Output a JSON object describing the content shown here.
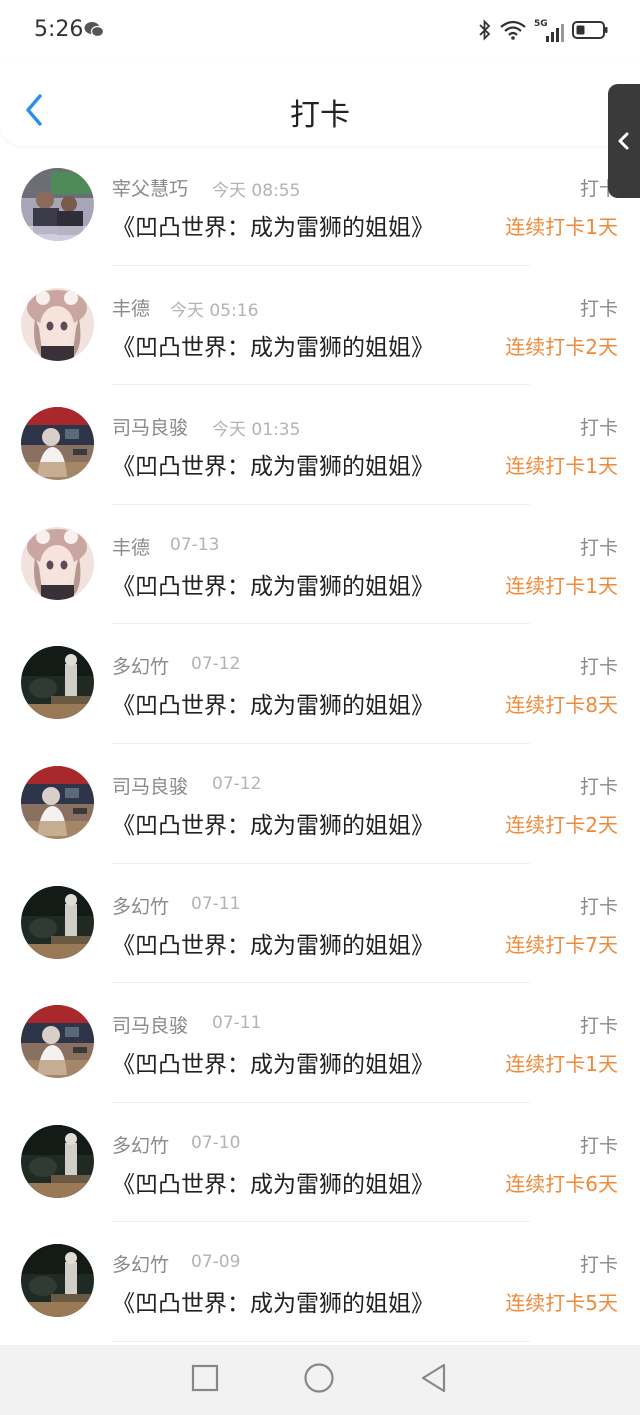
{
  "status_bar": {
    "time": "5:26",
    "network": "5G"
  },
  "header": {
    "title": "打卡"
  },
  "rows": [
    {
      "name": "宰父慧巧",
      "time": "今天 08:55",
      "book": "《凹凸世界：成为雷狮的姐姐》",
      "action": "打卡",
      "streak": "连续打卡1天",
      "avatar_style": "photo-group"
    },
    {
      "name": "丰德",
      "time": "今天 05:16",
      "book": "《凹凸世界：成为雷狮的姐姐》",
      "action": "打卡",
      "streak": "连续打卡2天",
      "avatar_style": "anime-girl"
    },
    {
      "name": "司马良骏",
      "time": "今天 01:35",
      "book": "《凹凸世界：成为雷狮的姐姐》",
      "action": "打卡",
      "streak": "连续打卡1天",
      "avatar_style": "classroom"
    },
    {
      "name": "丰德",
      "time": "07-13",
      "book": "《凹凸世界：成为雷狮的姐姐》",
      "action": "打卡",
      "streak": "连续打卡1天",
      "avatar_style": "anime-girl"
    },
    {
      "name": "多幻竹",
      "time": "07-12",
      "book": "《凹凸世界：成为雷狮的姐姐》",
      "action": "打卡",
      "streak": "连续打卡8天",
      "avatar_style": "dark-room"
    },
    {
      "name": "司马良骏",
      "time": "07-12",
      "book": "《凹凸世界：成为雷狮的姐姐》",
      "action": "打卡",
      "streak": "连续打卡2天",
      "avatar_style": "classroom"
    },
    {
      "name": "多幻竹",
      "time": "07-11",
      "book": "《凹凸世界：成为雷狮的姐姐》",
      "action": "打卡",
      "streak": "连续打卡7天",
      "avatar_style": "dark-room"
    },
    {
      "name": "司马良骏",
      "time": "07-11",
      "book": "《凹凸世界：成为雷狮的姐姐》",
      "action": "打卡",
      "streak": "连续打卡1天",
      "avatar_style": "classroom"
    },
    {
      "name": "多幻竹",
      "time": "07-10",
      "book": "《凹凸世界：成为雷狮的姐姐》",
      "action": "打卡",
      "streak": "连续打卡6天",
      "avatar_style": "dark-room"
    },
    {
      "name": "多幻竹",
      "time": "07-09",
      "book": "《凹凸世界：成为雷狮的姐姐》",
      "action": "打卡",
      "streak": "连续打卡5天",
      "avatar_style": "dark-room"
    }
  ],
  "colors": {
    "accent_blue": "#2a8df0",
    "streak_orange": "#f08a3a"
  },
  "icons": {
    "back": "back-chevron-icon",
    "side": "side-chevron-icon",
    "nav_recent": "square-icon",
    "nav_home": "circle-icon",
    "nav_back": "triangle-back-icon"
  }
}
